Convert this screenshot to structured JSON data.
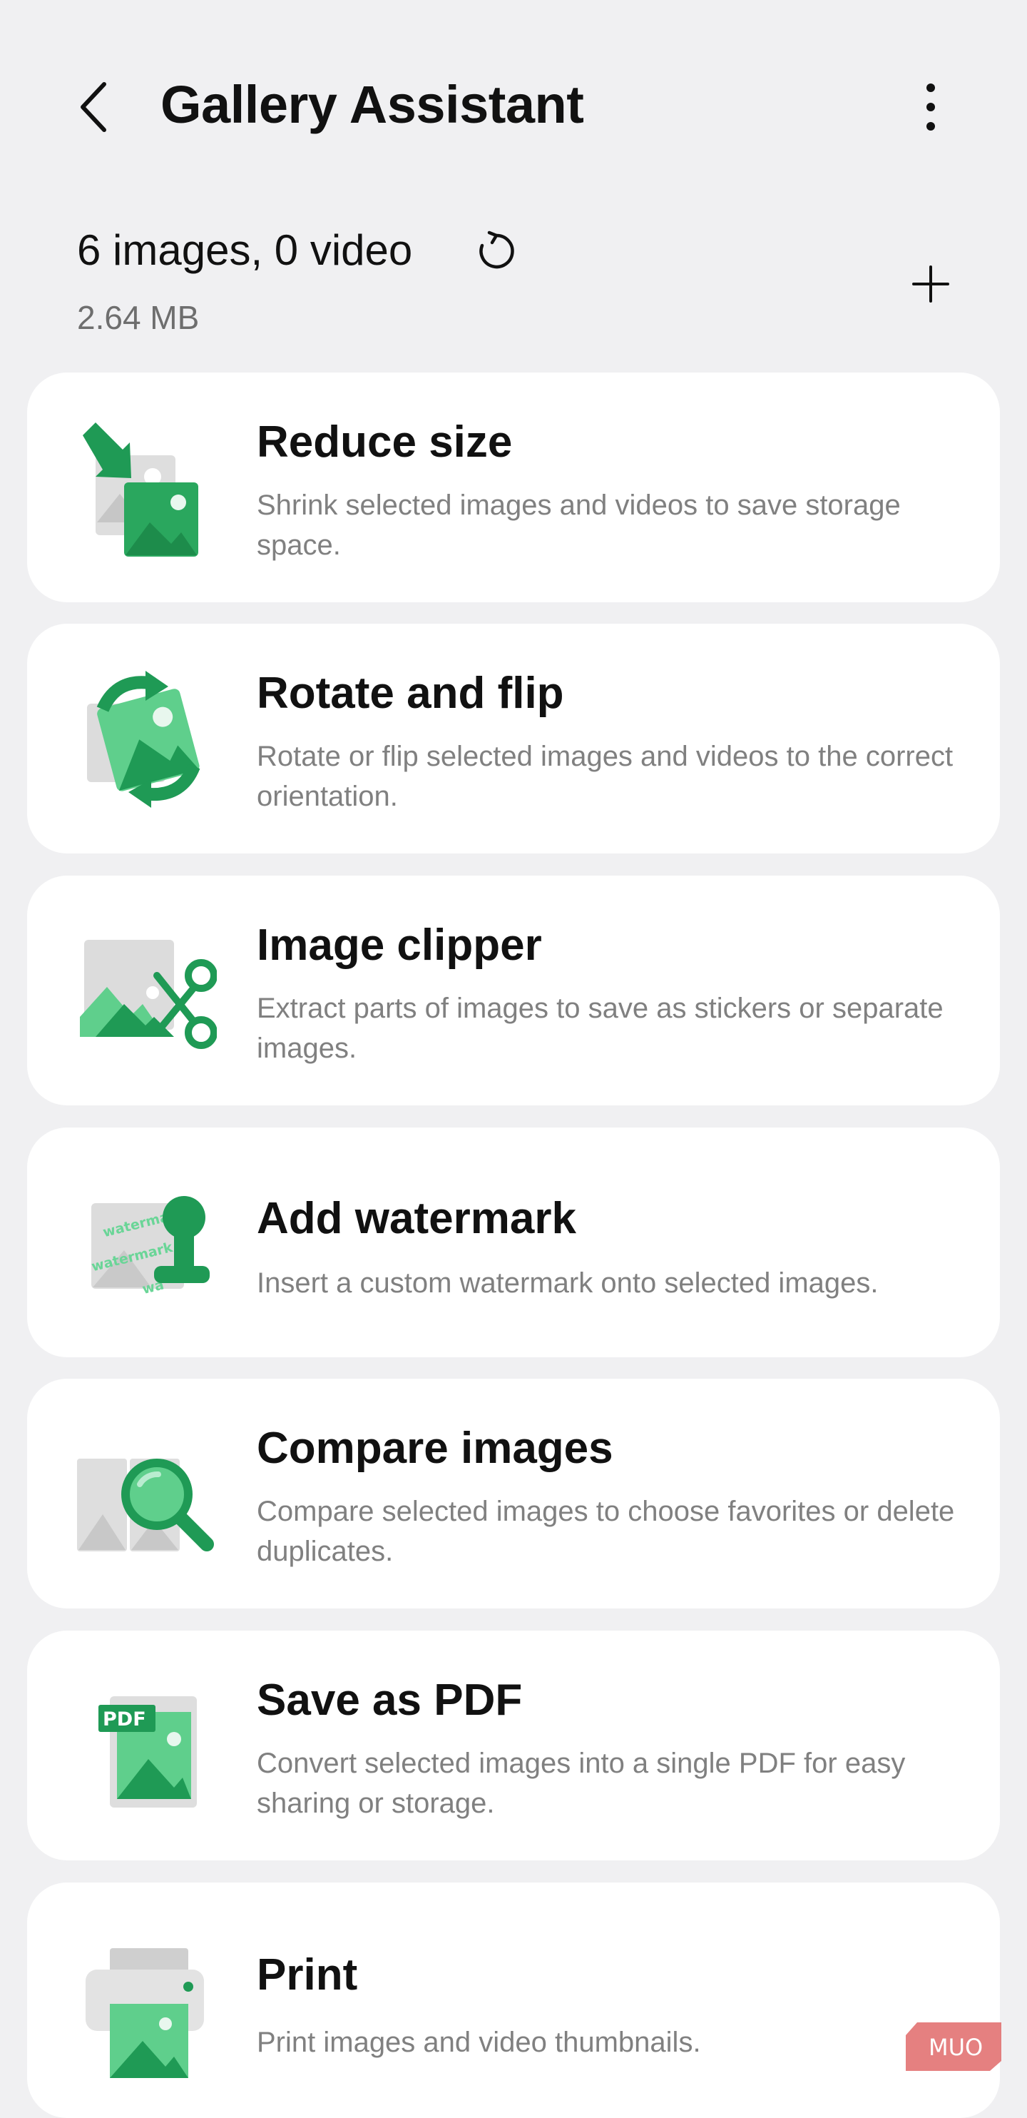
{
  "header": {
    "title": "Gallery Assistant",
    "back_icon": "chevron-left-icon",
    "more_icon": "more-vertical-icon"
  },
  "summary": {
    "counts": "6 images, 0 video",
    "size": "2.64 MB",
    "refresh_icon": "refresh-icon",
    "add_icon": "plus-icon"
  },
  "tools": [
    {
      "title": "Reduce size",
      "description": "Shrink selected images and videos to save storage space.",
      "icon": "reduce-size-icon"
    },
    {
      "title": "Rotate and flip",
      "description": "Rotate or flip selected images and videos to the correct orientation.",
      "icon": "rotate-flip-icon"
    },
    {
      "title": "Image clipper",
      "description": "Extract parts of images to save as stickers or separate images.",
      "icon": "scissors-image-icon"
    },
    {
      "title": "Add watermark",
      "description": "Insert a custom watermark onto selected images.",
      "icon": "stamp-icon"
    },
    {
      "title": "Compare images",
      "description": "Compare selected images to choose favorites or delete duplicates.",
      "icon": "magnifier-compare-icon"
    },
    {
      "title": "Save as PDF",
      "description": "Convert selected images into a single PDF for easy sharing or storage.",
      "icon": "pdf-icon"
    },
    {
      "title": "Print",
      "description": "Print images and video thumbnails.",
      "icon": "printer-icon"
    }
  ],
  "icon_text": {
    "watermark_1": "watermark",
    "watermark_2": "watermark",
    "watermark_3": "wa",
    "pdf_badge": "PDF"
  },
  "brand_watermark": "MUO",
  "colors": {
    "background": "#f0f0f2",
    "card": "#ffffff",
    "accent_green": "#1f9a55",
    "light_green": "#5fcf8c",
    "secondary_text": "#808080"
  }
}
